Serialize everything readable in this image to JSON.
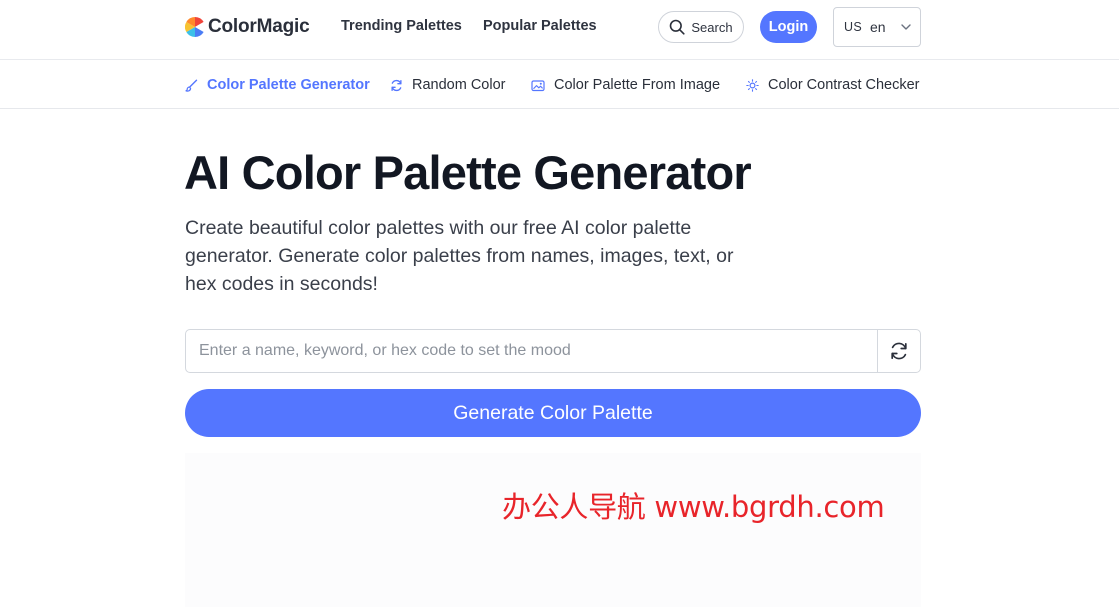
{
  "header": {
    "brand": "ColorMagic",
    "nav": [
      "Trending Palettes",
      "Popular Palettes"
    ],
    "search_label": "Search",
    "login_label": "Login",
    "language": {
      "region": "US",
      "code": "en"
    }
  },
  "subnav": {
    "items": [
      {
        "label": "Color Palette Generator",
        "icon": "brush-icon",
        "active": true
      },
      {
        "label": "Random Color",
        "icon": "refresh-icon",
        "active": false
      },
      {
        "label": "Color Palette From Image",
        "icon": "image-icon",
        "active": false
      },
      {
        "label": "Color Contrast Checker",
        "icon": "sun-icon",
        "active": false
      }
    ]
  },
  "hero": {
    "title": "AI Color Palette Generator",
    "description": "Create beautiful color palettes with our free AI color palette generator. Generate color palettes from names, images, text, or hex codes in seconds!"
  },
  "form": {
    "placeholder": "Enter a name, keyword, or hex code to set the mood",
    "value": "",
    "generate_label": "Generate Color Palette"
  },
  "watermark": "办公人导航 www.bgrdh.com",
  "colors": {
    "accent": "#5476ff",
    "text_dark": "#121722",
    "watermark": "#e8242a"
  }
}
